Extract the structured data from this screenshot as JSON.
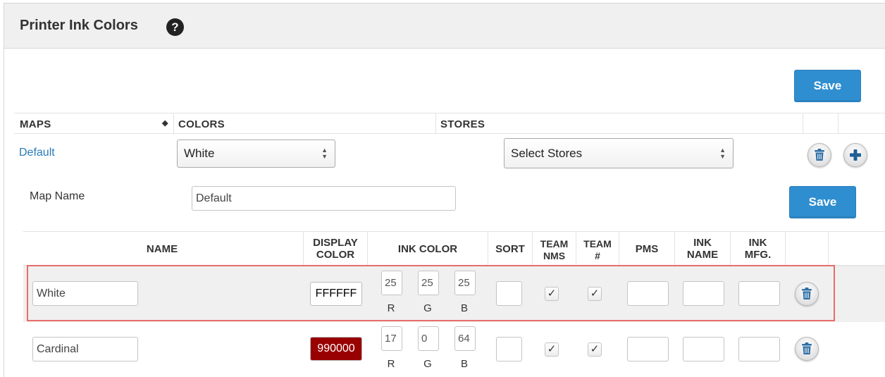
{
  "panel": {
    "title": "Printer Ink Colors",
    "help_glyph": "?"
  },
  "toolbar": {
    "save_label": "Save"
  },
  "maps_table": {
    "headers": {
      "maps": "MAPS",
      "colors": "COLORS",
      "stores": "STORES"
    },
    "sort_glyph": "◆"
  },
  "map_row": {
    "name_link": "Default",
    "color_select": "White",
    "stores_select": "Select Stores"
  },
  "map_editor": {
    "label": "Map Name",
    "value": "Default",
    "save_label": "Save"
  },
  "colors_table": {
    "headers": {
      "name": "NAME",
      "display_color_1": "DISPLAY",
      "display_color_2": "COLOR",
      "ink_color": "INK COLOR",
      "sort": "SORT",
      "team_nms_1": "TEAM",
      "team_nms_2": "NMS",
      "team_num_1": "TEAM",
      "team_num_2": "#",
      "pms": "PMS",
      "ink_name_1": "INK",
      "ink_name_2": "NAME",
      "ink_mfg_1": "INK",
      "ink_mfg_2": "MFG."
    },
    "rgb_labels": {
      "r": "R",
      "g": "G",
      "b": "B"
    },
    "check_glyph": "✓",
    "rows": [
      {
        "name": "White",
        "display": "FFFFFF",
        "r": "25",
        "g": "25",
        "b": "25",
        "swatch_bg": "#ffffff",
        "swatch_fg": "#000000"
      },
      {
        "name": "Cardinal",
        "display": "990000",
        "r": "17",
        "g": "0",
        "b": "64",
        "swatch_bg": "#990000",
        "swatch_fg": "#ffffff"
      }
    ]
  },
  "colors": {
    "accent": "#2f8ed0",
    "link": "#2a7ab8",
    "highlight": "#ea6b6b"
  },
  "icons": [
    "help-icon",
    "sort-icon",
    "trash-icon",
    "plus-icon",
    "checkmark-icon",
    "select-arrows-icon"
  ]
}
